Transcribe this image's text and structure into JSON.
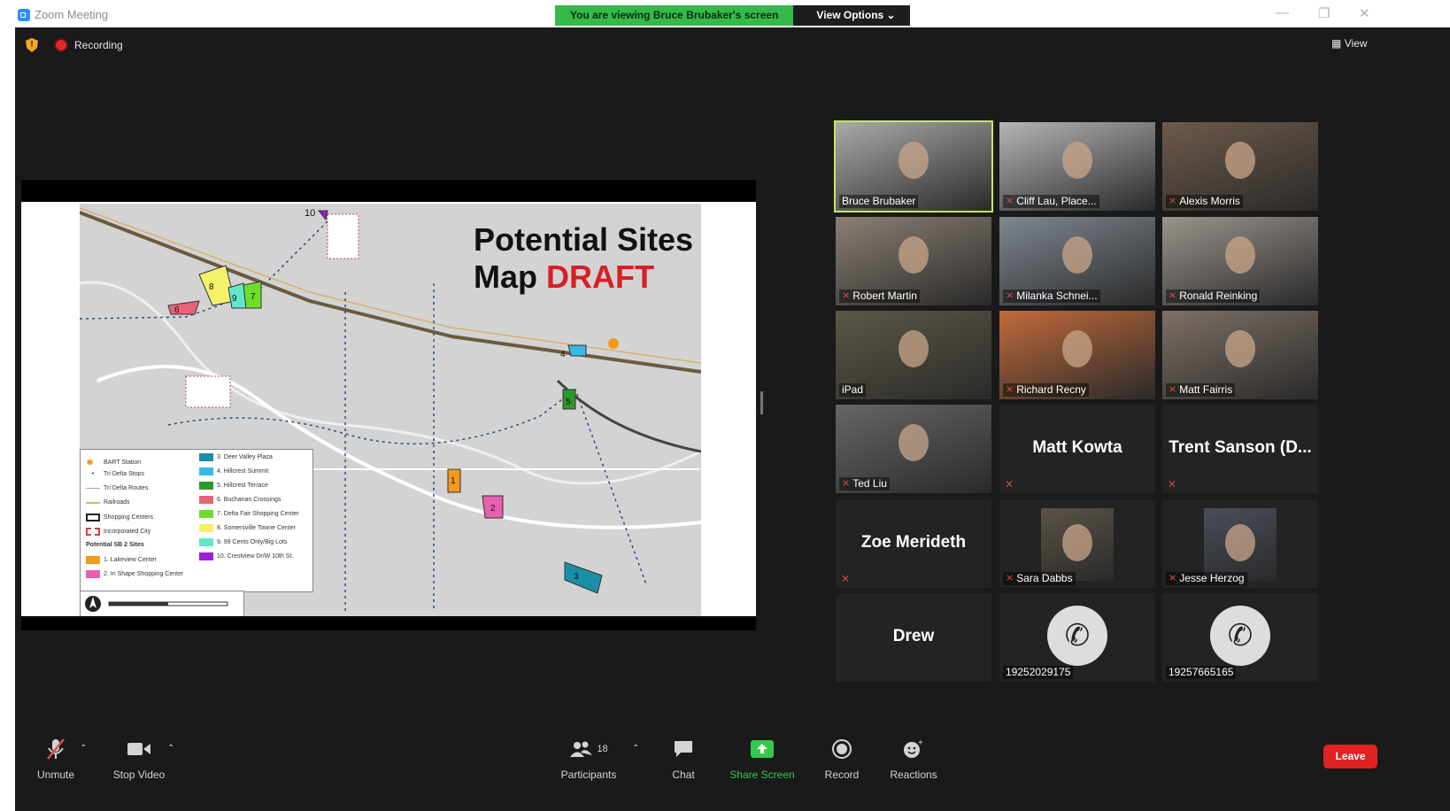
{
  "window": {
    "title": "Zoom Meeting",
    "minimize_glyph": "—",
    "maximize_glyph": "❐",
    "close_glyph": "✕"
  },
  "banner": {
    "viewing": "You are viewing Bruce Brubaker's screen",
    "view_options": "View Options ⌄"
  },
  "status": {
    "recording": "Recording",
    "view": "View",
    "view_glyph": "▦"
  },
  "slide": {
    "title_line1": "Potential Sites",
    "title_line2_prefix": "Map ",
    "title_line2_emph": "DRAFT"
  },
  "legend": {
    "left": [
      "BART Station",
      "Tri Delta Stops",
      "Tri Delta Routes",
      "Railroads",
      "Shopping Centers",
      "Incorporated City",
      "Potential SB 2 Sites",
      "1. Lakeview Center",
      "2. In Shape Shopping Center"
    ],
    "right": [
      "3. Deer Valley Plaza",
      "4. Hillcrest Summit",
      "5. Hillcrest Terrace",
      "6. Buchanan Crossings",
      "7. Delta Fair Shopping Center",
      "8. Somersville Towne Center",
      "9. 99 Cents Only/Big Lots",
      "10. Crestview Dr/W 10th St."
    ],
    "colors_right": [
      "#1b8fa6",
      "#35b9e8",
      "#2a9a2a",
      "#e8637a",
      "#6ddd2a",
      "#f4f06a",
      "#5ee8c8",
      "#9b1fd6"
    ],
    "colors_left_sites": [
      "#f29a1c",
      "#e85fae"
    ]
  },
  "participants": [
    {
      "name": "Bruce Brubaker",
      "muted": false,
      "active": true,
      "photo": "#aaa"
    },
    {
      "name": "Cliff Lau, Place...",
      "muted": true,
      "photo": "#b5b5b5"
    },
    {
      "name": "Alexis Morris",
      "muted": true,
      "photo": "#6e5a4a"
    },
    {
      "name": "Robert Martin",
      "muted": true,
      "photo": "#8a7f74"
    },
    {
      "name": "Milanka Schnei...",
      "muted": true,
      "photo": "#7f8790"
    },
    {
      "name": "Ronald Reinking",
      "muted": true,
      "photo": "#9a938c"
    },
    {
      "name": "iPad",
      "muted": false,
      "photo": "#5c5846"
    },
    {
      "name": "Richard Recny",
      "muted": true,
      "photo": "#c26a3a"
    },
    {
      "name": "Matt Fairris",
      "muted": true,
      "photo": "#7d7066"
    },
    {
      "name": "Ted Liu",
      "muted": true,
      "photo": "#666"
    },
    {
      "name": "Matt Kowta",
      "muted": true,
      "no_video": true
    },
    {
      "name": "Trent Sanson (D...",
      "muted": true,
      "no_video": true
    },
    {
      "name": "Zoe Merideth",
      "muted": true,
      "no_video": true
    },
    {
      "name": "Sara Dabbs",
      "muted": true,
      "photo": "#5a5346",
      "small_photo": true
    },
    {
      "name": "Jesse Herzog",
      "muted": true,
      "photo": "#4a4e5a",
      "small_photo": true
    },
    {
      "name": "Drew",
      "muted": false,
      "no_video": true
    },
    {
      "name": "19252029175",
      "muted": false,
      "phone": true
    },
    {
      "name": "19257665165",
      "muted": false,
      "phone": true
    }
  ],
  "toolbar": {
    "unmute": "Unmute",
    "stop_video": "Stop Video",
    "participants": "Participants",
    "participants_count": "18",
    "chat": "Chat",
    "share_screen": "Share Screen",
    "record": "Record",
    "reactions": "Reactions",
    "leave": "Leave"
  },
  "colors": {
    "accent_green": "#35b94b",
    "leave_red": "#df2222",
    "active_speaker": "#c6e85b"
  }
}
